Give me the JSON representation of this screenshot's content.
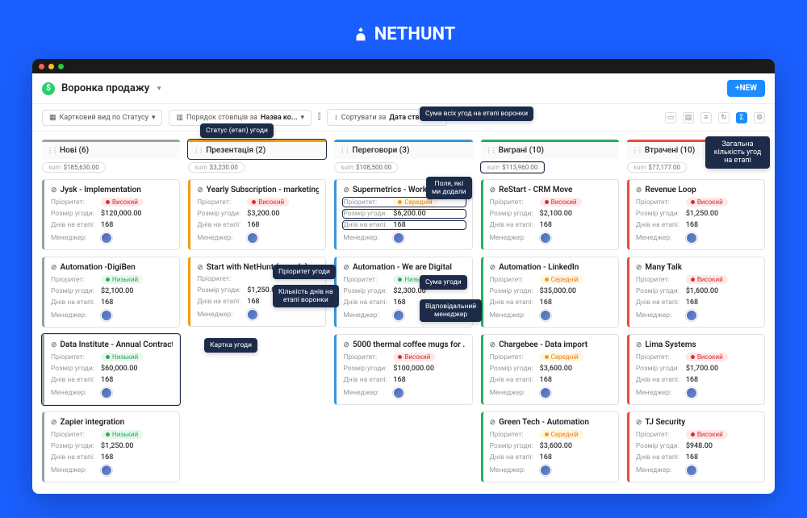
{
  "brand": "NETHUNT",
  "page_title": "Воронка продажу",
  "new_button": "+NEW",
  "toolbar": {
    "view": "Картковий вид по Статусу",
    "columns_prefix": "Порядок стовпців за",
    "columns_val": "Назва ко...",
    "sort_prefix": "Сортувати за",
    "sort_val": "Дата створенн"
  },
  "callouts": {
    "stage": "Статус (етап) угоди",
    "sum_all": "Сума всіх угод на етапі воронки",
    "total_count": "Загальна\nкількість угод\nна етапі",
    "fields_added": "Поля, які\nми додали",
    "priority": "Пріоритет угоди",
    "days": "Кількість днів на\nетапі воронки",
    "amount": "Сума угоди",
    "manager": "Відповідальний\nменеджер",
    "card": "Картка угоди"
  },
  "labels": {
    "priority": "Пріоритет:",
    "amount": "Розмір угоди:",
    "days": "Днів на етапі:",
    "manager": "Менеджер:",
    "sum": "sum"
  },
  "priority_names": {
    "high": "Високий",
    "low": "Низький",
    "mid": "Середній"
  },
  "columns": [
    {
      "name": "Нові (6)",
      "color": "#9aa0a6",
      "sum": "$185,630.00",
      "cards": [
        {
          "title": "Jysk - Implementation",
          "priority": "high",
          "amount": "$120,000.00",
          "days": "168"
        },
        {
          "title": "Automation -DigiBen",
          "priority": "low",
          "amount": "$2,100.00",
          "days": "168"
        },
        {
          "title": "Data Institute - Annual Contract",
          "priority": "low",
          "amount": "$60,000.00",
          "days": "168"
        },
        {
          "title": "Zapier integration",
          "priority": "low",
          "amount": "$1,250.00",
          "days": "168"
        }
      ]
    },
    {
      "name": "Презентація (2)",
      "color": "#f39c12",
      "sum": "$3,230.00",
      "cards": [
        {
          "title": "Yearly Subscription - marketing t...",
          "priority": "high",
          "amount": "$3,200.00",
          "days": "168"
        },
        {
          "title": "Start with NetHunt (sample)",
          "priority": "",
          "amount": "$1,250.00",
          "days": "168"
        }
      ]
    },
    {
      "name": "Переговори (3)",
      "color": "#3498db",
      "sum": "$108,500.00",
      "cards": [
        {
          "title": "Supermetrics - Workflows imple...",
          "priority": "mid",
          "amount": "$6,200.00",
          "days": "168"
        },
        {
          "title": "Automation - We are Digital",
          "priority": "low",
          "amount": "$2,300.00",
          "days": "168"
        },
        {
          "title": "5000 thermal coffee mugs for ...",
          "priority": "high",
          "amount": "$100,000.00",
          "days": "168"
        }
      ]
    },
    {
      "name": "Виграні (10)",
      "color": "#27ae60",
      "sum": "$113,960.00",
      "cards": [
        {
          "title": "ReStart - CRM Move",
          "priority": "high",
          "amount": "$2,100.00",
          "days": "168"
        },
        {
          "title": "Automation - LinkedIn",
          "priority": "mid",
          "amount": "$35,000.00",
          "days": "168"
        },
        {
          "title": "Chargebee - Data import",
          "priority": "mid",
          "amount": "$3,600.00",
          "days": "168"
        },
        {
          "title": "Green Tech - Automation",
          "priority": "mid",
          "amount": "$3,600.00",
          "days": "168"
        }
      ]
    },
    {
      "name": "Втрачені (10)",
      "color": "#e74c3c",
      "sum": "$77,177.00",
      "cards": [
        {
          "title": "Revenue Loop",
          "priority": "high",
          "amount": "$1,250.00",
          "days": "168"
        },
        {
          "title": "Many Talk",
          "priority": "high",
          "amount": "$1,600.00",
          "days": "168"
        },
        {
          "title": "Lima Systems",
          "priority": "high",
          "amount": "$1,700.00",
          "days": "168"
        },
        {
          "title": "TJ Security",
          "priority": "high",
          "amount": "$948.00",
          "days": "168"
        }
      ]
    }
  ]
}
